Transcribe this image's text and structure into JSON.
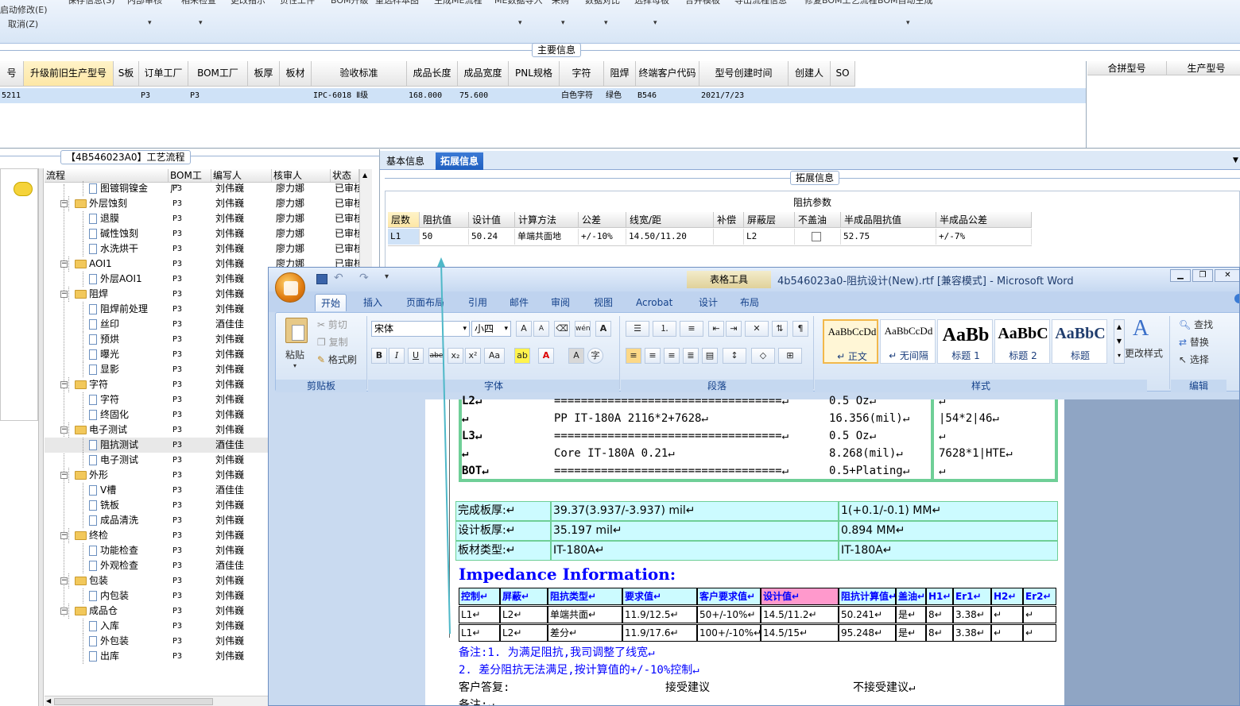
{
  "toolbar": {
    "menu_row1": [
      "启动修改(E)",
      "保存信息(S)",
      "内部审核",
      "相来检查",
      "更改指示",
      "负性工件",
      "BOM升级",
      "重选样本图",
      "生成ME流程",
      "ME数据导入",
      "采购",
      "数据对比",
      "选择母板",
      "合并模板",
      "导出流程信息",
      "修复BOM工艺流程",
      "BOM自动生成"
    ],
    "menu_row2": [
      "取消(Z)"
    ]
  },
  "main_info": {
    "title": "主要信息",
    "columns": [
      "号",
      "升级前旧生产型号",
      "S板",
      "订单工厂",
      "BOM工厂",
      "板厚",
      "板材",
      "验收标准",
      "成品长度",
      "成品宽度",
      "PNL规格",
      "字符",
      "阻焊",
      "终端客户代码",
      "型号创建时间",
      "创建人",
      "SO"
    ],
    "row": [
      "5211",
      "",
      "",
      "P3",
      "P3",
      "",
      "",
      "IPC-6018 Ⅱ级",
      "168.000",
      "75.600",
      "",
      "白色字符",
      "绿色",
      "B546",
      "2021/7/23",
      "",
      ""
    ],
    "side_columns": [
      "合拼型号",
      "生产型号"
    ]
  },
  "process": {
    "title": "【4B546023A0】工艺流程",
    "columns": [
      "流程",
      "BOM工厂",
      "编写人",
      "核审人",
      "状态"
    ],
    "rows": [
      {
        "name": "图镀铜镍金",
        "type": "doc",
        "level": 2,
        "bom": "P3",
        "author": "刘伟巍",
        "reviewer": "廖力娜",
        "status": "已审核"
      },
      {
        "name": "外层蚀刻",
        "type": "folder",
        "level": 1,
        "bom": "P3",
        "author": "刘伟巍",
        "reviewer": "廖力娜",
        "status": "已审核"
      },
      {
        "name": "退膜",
        "type": "doc",
        "level": 2,
        "bom": "P3",
        "author": "刘伟巍",
        "reviewer": "廖力娜",
        "status": "已审核"
      },
      {
        "name": "碱性蚀刻",
        "type": "doc",
        "level": 2,
        "bom": "P3",
        "author": "刘伟巍",
        "reviewer": "廖力娜",
        "status": "已审核"
      },
      {
        "name": "水洗烘干",
        "type": "doc",
        "level": 2,
        "bom": "P3",
        "author": "刘伟巍",
        "reviewer": "廖力娜",
        "status": "已审核"
      },
      {
        "name": "AOI1",
        "type": "folder",
        "level": 1,
        "bom": "P3",
        "author": "刘伟巍",
        "reviewer": "廖力娜",
        "status": "已审核"
      },
      {
        "name": "外层AOI1",
        "type": "doc",
        "level": 2,
        "bom": "P3",
        "author": "刘伟巍",
        "reviewer": "",
        "status": ""
      },
      {
        "name": "阻焊",
        "type": "folder",
        "level": 1,
        "bom": "P3",
        "author": "刘伟巍",
        "reviewer": "",
        "status": ""
      },
      {
        "name": "阻焊前处理",
        "type": "doc",
        "level": 2,
        "bom": "P3",
        "author": "刘伟巍",
        "reviewer": "",
        "status": ""
      },
      {
        "name": "丝印",
        "type": "doc",
        "level": 2,
        "bom": "P3",
        "author": "酒佳佳",
        "reviewer": "",
        "status": ""
      },
      {
        "name": "预烘",
        "type": "doc",
        "level": 2,
        "bom": "P3",
        "author": "刘伟巍",
        "reviewer": "",
        "status": ""
      },
      {
        "name": "曝光",
        "type": "doc",
        "level": 2,
        "bom": "P3",
        "author": "刘伟巍",
        "reviewer": "",
        "status": ""
      },
      {
        "name": "显影",
        "type": "doc",
        "level": 2,
        "bom": "P3",
        "author": "刘伟巍",
        "reviewer": "",
        "status": ""
      },
      {
        "name": "字符",
        "type": "folder",
        "level": 1,
        "bom": "P3",
        "author": "刘伟巍",
        "reviewer": "",
        "status": ""
      },
      {
        "name": "字符",
        "type": "doc",
        "level": 2,
        "bom": "P3",
        "author": "刘伟巍",
        "reviewer": "",
        "status": ""
      },
      {
        "name": "终固化",
        "type": "doc",
        "level": 2,
        "bom": "P3",
        "author": "刘伟巍",
        "reviewer": "",
        "status": ""
      },
      {
        "name": "电子测试",
        "type": "folder",
        "level": 1,
        "bom": "P3",
        "author": "刘伟巍",
        "reviewer": "",
        "status": ""
      },
      {
        "name": "阻抗测试",
        "type": "doc",
        "level": 2,
        "bom": "P3",
        "author": "酒佳佳",
        "reviewer": "",
        "status": ""
      },
      {
        "name": "电子测试",
        "type": "doc",
        "level": 2,
        "bom": "P3",
        "author": "刘伟巍",
        "reviewer": "",
        "status": ""
      },
      {
        "name": "外形",
        "type": "folder",
        "level": 1,
        "bom": "P3",
        "author": "刘伟巍",
        "reviewer": "",
        "status": ""
      },
      {
        "name": "V槽",
        "type": "doc",
        "level": 2,
        "bom": "P3",
        "author": "酒佳佳",
        "reviewer": "",
        "status": ""
      },
      {
        "name": "铣板",
        "type": "doc",
        "level": 2,
        "bom": "P3",
        "author": "刘伟巍",
        "reviewer": "",
        "status": ""
      },
      {
        "name": "成品清洗",
        "type": "doc",
        "level": 2,
        "bom": "P3",
        "author": "刘伟巍",
        "reviewer": "",
        "status": ""
      },
      {
        "name": "终检",
        "type": "folder",
        "level": 1,
        "bom": "P3",
        "author": "刘伟巍",
        "reviewer": "",
        "status": ""
      },
      {
        "name": "功能检查",
        "type": "doc",
        "level": 2,
        "bom": "P3",
        "author": "刘伟巍",
        "reviewer": "",
        "status": ""
      },
      {
        "name": "外观检查",
        "type": "doc",
        "level": 2,
        "bom": "P3",
        "author": "酒佳佳",
        "reviewer": "",
        "status": ""
      },
      {
        "name": "包装",
        "type": "folder",
        "level": 1,
        "bom": "P3",
        "author": "刘伟巍",
        "reviewer": "",
        "status": ""
      },
      {
        "name": "内包装",
        "type": "doc",
        "level": 2,
        "bom": "P3",
        "author": "刘伟巍",
        "reviewer": "",
        "status": ""
      },
      {
        "name": "成品仓",
        "type": "folder",
        "level": 1,
        "bom": "P3",
        "author": "刘伟巍",
        "reviewer": "",
        "status": ""
      },
      {
        "name": "入库",
        "type": "doc",
        "level": 2,
        "bom": "P3",
        "author": "刘伟巍",
        "reviewer": "",
        "status": ""
      },
      {
        "name": "外包装",
        "type": "doc",
        "level": 2,
        "bom": "P3",
        "author": "刘伟巍",
        "reviewer": "",
        "status": ""
      },
      {
        "name": "出库",
        "type": "doc",
        "level": 2,
        "bom": "P3",
        "author": "刘伟巍",
        "reviewer": "",
        "status": ""
      }
    ]
  },
  "detail": {
    "tabs": [
      "基本信息",
      "拓展信息"
    ],
    "group_title": "拓展信息",
    "imp_title": "阻抗参数",
    "columns": [
      "层数",
      "阻抗值",
      "设计值",
      "计算方法",
      "公差",
      "线宽/距",
      "补偿",
      "屏蔽层",
      "不盖油",
      "半成品阻抗值",
      "半成品公差"
    ],
    "row": [
      "L1",
      "50",
      "50.24",
      "单端共面地",
      "+/-10%",
      "14.50/11.20",
      "",
      "L2",
      "",
      "52.75",
      "+/-7%"
    ]
  },
  "word": {
    "title": "4b546023a0-阻抗设计(New).rtf [兼容模式] - Microsoft Word",
    "context_tool": "表格工具",
    "tabs": [
      "开始",
      "插入",
      "页面布局",
      "引用",
      "邮件",
      "审阅",
      "视图",
      "Acrobat",
      "设计",
      "布局"
    ],
    "clipboard": {
      "paste": "粘贴",
      "cut": "剪切",
      "copy": "复制",
      "format": "格式刷",
      "label": "剪贴板"
    },
    "font": {
      "name": "宋体",
      "size": "小四",
      "label": "字体"
    },
    "paragraph_label": "段落",
    "styles": [
      {
        "preview": "AaBbCcDd",
        "label": "↵ 正文"
      },
      {
        "preview": "AaBbCcDd",
        "label": "↵ 无间隔"
      },
      {
        "preview": "AaBb",
        "label": "标题 1"
      },
      {
        "preview": "AaBbC",
        "label": "标题 2"
      },
      {
        "preview": "AaBbC",
        "label": "标题"
      }
    ],
    "styles_label": "样式",
    "change_styles": "更改样式",
    "edit": {
      "find": "查找",
      "replace": "替换",
      "select": "选择",
      "label": "编辑"
    }
  },
  "document": {
    "stack": [
      {
        "layer": "L2↵",
        "rule": "==================================↵",
        "val": "0.5 Oz↵",
        "right": "↵"
      },
      {
        "layer": "↵",
        "rule": "PP     IT-180A   2116*2+7628↵",
        "val": "16.356(mil)↵",
        "right": "|54*2|46↵"
      },
      {
        "layer": "L3↵",
        "rule": "==================================↵",
        "val": "0.5 Oz↵",
        "right": "↵"
      },
      {
        "layer": "↵",
        "rule": "Core     IT-180A   0.21↵",
        "val": "8.268(mil)↵",
        "right": "7628*1|HTE↵"
      },
      {
        "layer": "BOT↵",
        "rule": "==================================↵",
        "val": "0.5+Plating↵",
        "right": "↵"
      }
    ],
    "thickness": [
      [
        "完成板厚:↵",
        "39.37(3.937/-3.937) mil↵",
        "1(+0.1/-0.1) MM↵"
      ],
      [
        "设计板厚:↵",
        "35.197 mil↵",
        "0.894 MM↵"
      ],
      [
        "板材类型:↵",
        "IT-180A↵",
        "IT-180A↵"
      ]
    ],
    "heading": "Impedance Information:",
    "imp_headers": [
      "控制↵",
      "屏蔽↵",
      "阻抗类型↵",
      "要求值↵",
      "客户要求值↵",
      "设计值↵",
      "阻抗计算值↵",
      "盖油↵",
      "H1↵",
      "Er1↵",
      "H2↵",
      "Er2↵"
    ],
    "imp_rows": [
      [
        "L1↵",
        "L2↵",
        "单端共面↵",
        "11.9/12.5↵",
        "50+/-10%↵",
        "14.5/11.2↵",
        "50.241↵",
        "是↵",
        "8↵",
        "3.38↵",
        "↵",
        "↵"
      ],
      [
        "L1↵",
        "L2↵",
        "差分↵",
        "11.9/17.6↵",
        "100+/-10%↵",
        "14.5/15↵",
        "95.248↵",
        "是↵",
        "8↵",
        "3.38↵",
        "↵",
        "↵"
      ]
    ],
    "note1": "备注:1. 为满足阻抗,我司调整了线宽↵",
    "note2": "2. 差分阻抗无法满足,按计算值的+/-10%控制↵",
    "answer_label": "客户答复:",
    "accept": "接受建议",
    "reject": "不接受建议↵",
    "note3": "备注:↵"
  },
  "colors": {
    "accent": "#cfe2f7",
    "header_yellow": "#fde7a6",
    "doc_teal_border": "#6fcf97",
    "doc_cyan": "#ccfbff",
    "doc_pink": "#ff99cc",
    "doc_blue": "#0000ff"
  }
}
